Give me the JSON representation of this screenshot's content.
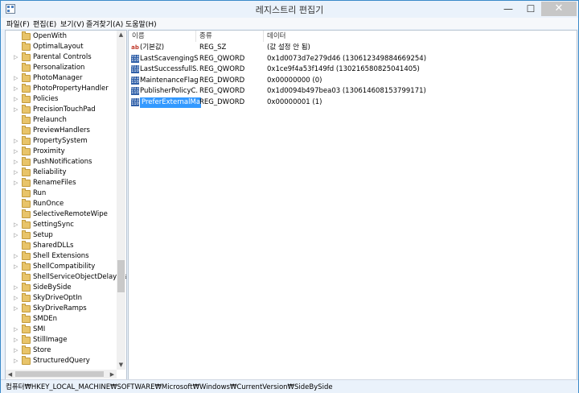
{
  "window": {
    "title": "레지스트리 편집기",
    "minimize": "—",
    "maximize": "☐",
    "close": "✕"
  },
  "menu": [
    "파일(F)",
    "편집(E)",
    "보기(V)",
    "즐겨찾기(A)",
    "도움말(H)"
  ],
  "tree": {
    "items": [
      {
        "label": "OpenWith",
        "expandable": false
      },
      {
        "label": "OptimalLayout",
        "expandable": false
      },
      {
        "label": "Parental Controls",
        "expandable": true
      },
      {
        "label": "Personalization",
        "expandable": false
      },
      {
        "label": "PhotoManager",
        "expandable": true
      },
      {
        "label": "PhotoPropertyHandler",
        "expandable": true
      },
      {
        "label": "Policies",
        "expandable": true
      },
      {
        "label": "PrecisionTouchPad",
        "expandable": true
      },
      {
        "label": "Prelaunch",
        "expandable": false
      },
      {
        "label": "PreviewHandlers",
        "expandable": false
      },
      {
        "label": "PropertySystem",
        "expandable": true
      },
      {
        "label": "Proximity",
        "expandable": true
      },
      {
        "label": "PushNotifications",
        "expandable": true
      },
      {
        "label": "Reliability",
        "expandable": true
      },
      {
        "label": "RenameFiles",
        "expandable": true
      },
      {
        "label": "Run",
        "expandable": false
      },
      {
        "label": "RunOnce",
        "expandable": false
      },
      {
        "label": "SelectiveRemoteWipe",
        "expandable": false
      },
      {
        "label": "SettingSync",
        "expandable": true
      },
      {
        "label": "Setup",
        "expandable": true
      },
      {
        "label": "SharedDLLs",
        "expandable": false
      },
      {
        "label": "Shell Extensions",
        "expandable": true
      },
      {
        "label": "ShellCompatibility",
        "expandable": true
      },
      {
        "label": "ShellServiceObjectDelayLoa",
        "expandable": false
      },
      {
        "label": "SideBySide",
        "expandable": true
      },
      {
        "label": "SkyDriveOptIn",
        "expandable": true
      },
      {
        "label": "SkyDriveRamps",
        "expandable": true
      },
      {
        "label": "SMDEn",
        "expandable": false
      },
      {
        "label": "SMI",
        "expandable": true
      },
      {
        "label": "StillImage",
        "expandable": true
      },
      {
        "label": "Store",
        "expandable": true
      },
      {
        "label": "StructuredQuery",
        "expandable": true
      }
    ]
  },
  "list": {
    "headers": {
      "name": "이름",
      "type": "종류",
      "data": "데이터"
    },
    "rows": [
      {
        "icon": "string-value-icon",
        "name": "(기본값)",
        "type": "REG_SZ",
        "data": "(값 설정 안 됨)",
        "selected": false
      },
      {
        "icon": "binary-value-icon",
        "name": "LastScavengingS...",
        "type": "REG_QWORD",
        "data": "0x1d0073d7e279d46 (130612349884669254)",
        "selected": false
      },
      {
        "icon": "binary-value-icon",
        "name": "LastSuccessfullS...",
        "type": "REG_QWORD",
        "data": "0x1ce9f4a53f149fd (130216580825041405)",
        "selected": false
      },
      {
        "icon": "binary-value-icon",
        "name": "MaintenanceFlags",
        "type": "REG_DWORD",
        "data": "0x00000000 (0)",
        "selected": false
      },
      {
        "icon": "binary-value-icon",
        "name": "PublisherPolicyC...",
        "type": "REG_QWORD",
        "data": "0x1d0094b497bea03 (130614608153799171)",
        "selected": false
      },
      {
        "icon": "binary-value-icon",
        "name": "PreferExternalMa...",
        "type": "REG_DWORD",
        "data": "0x00000001 (1)",
        "selected": true
      }
    ]
  },
  "status": "컴퓨터₩HKEY_LOCAL_MACHINE₩SOFTWARE₩Microsoft₩Windows₩CurrentVersion₩SideBySide",
  "colors": {
    "accent": "#3399ff",
    "border": "#3a8ac9"
  }
}
